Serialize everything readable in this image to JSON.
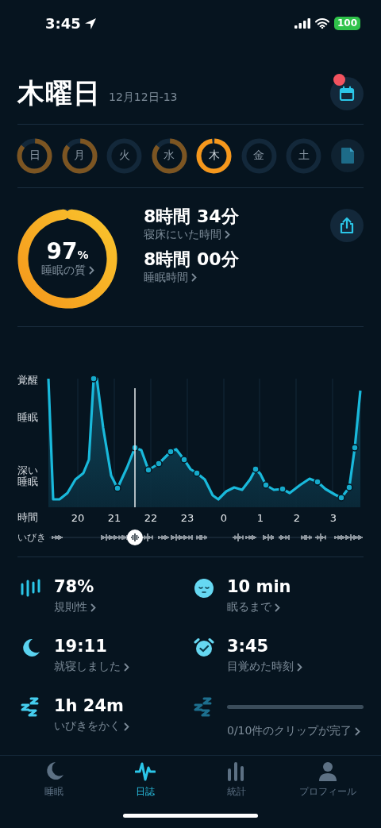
{
  "status_bar": {
    "time": "3:45",
    "battery": "100"
  },
  "header": {
    "title": "木曜日",
    "date": "12月12日-13",
    "notification": true
  },
  "days": [
    {
      "label": "日",
      "recorded": true,
      "selected": false
    },
    {
      "label": "月",
      "recorded": true,
      "selected": false
    },
    {
      "label": "火",
      "recorded": false,
      "selected": false
    },
    {
      "label": "水",
      "recorded": true,
      "selected": false
    },
    {
      "label": "木",
      "recorded": true,
      "selected": true
    },
    {
      "label": "金",
      "recorded": false,
      "selected": false
    },
    {
      "label": "土",
      "recorded": false,
      "selected": false
    }
  ],
  "summary": {
    "quality": {
      "value": "97",
      "unit": "%",
      "label": "睡眠の質"
    },
    "durations": [
      {
        "value": "8時間 34分",
        "label": "寝床にいた時間"
      },
      {
        "value": "8時間 00分",
        "label": "睡眠時間"
      }
    ]
  },
  "graph": {
    "y_labels": [
      "覚醒",
      "睡眠",
      "深い睡眠"
    ],
    "x_title": "時間",
    "x_ticks": [
      "20",
      "21",
      "22",
      "23",
      "0",
      "1",
      "2",
      "3"
    ],
    "snore_label": "いびき"
  },
  "stats": [
    {
      "kind": "regularity",
      "value": "78%",
      "label": "規則性"
    },
    {
      "kind": "fall-asleep",
      "value": "10 min",
      "label": "眠るまで"
    },
    {
      "kind": "bedtime",
      "value": "19:11",
      "label": "就寝しました"
    },
    {
      "kind": "wakeup",
      "value": "3:45",
      "label": "目覚めた時刻"
    },
    {
      "kind": "snoring",
      "value": "1h 24m",
      "label": "いびきをかく"
    },
    {
      "kind": "clips",
      "label": "0/10件のクリップが完了"
    }
  ],
  "tabs": [
    {
      "kind": "moon",
      "label": "睡眠",
      "selected": false
    },
    {
      "kind": "wave",
      "label": "日誌",
      "selected": true
    },
    {
      "kind": "bars",
      "label": "統計",
      "selected": false
    },
    {
      "kind": "person",
      "label": "プロフィール",
      "selected": false
    }
  ]
}
